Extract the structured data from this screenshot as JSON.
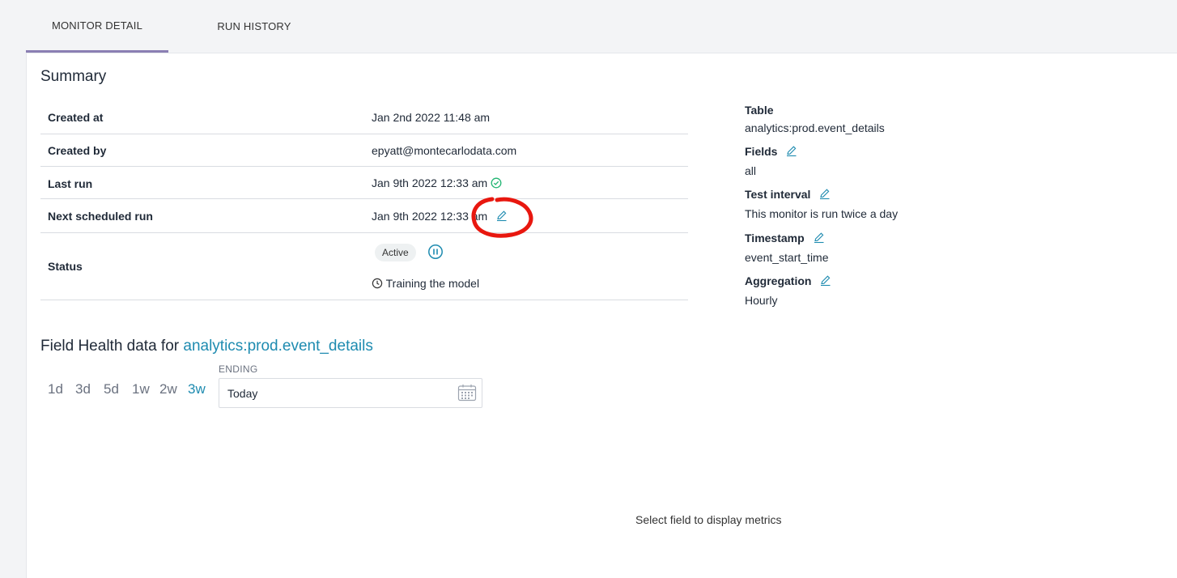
{
  "tabs": [
    {
      "label": "MONITOR DETAIL",
      "active": true
    },
    {
      "label": "RUN HISTORY",
      "active": false
    }
  ],
  "summary": {
    "title": "Summary",
    "rows": {
      "created_at": {
        "label": "Created at",
        "value": "Jan 2nd 2022 11:48 am"
      },
      "created_by": {
        "label": "Created by",
        "value": "epyatt@montecarlodata.com"
      },
      "last_run": {
        "label": "Last run",
        "value": "Jan 9th 2022 12:33 am"
      },
      "next_run": {
        "label": "Next scheduled run",
        "value": "Jan 9th 2022 12:33 am"
      },
      "status": {
        "label": "Status",
        "badge": "Active",
        "training": "Training the model"
      }
    }
  },
  "details": {
    "table": {
      "label": "Table",
      "value": "analytics:prod.event_details"
    },
    "fields": {
      "label": "Fields",
      "value": "all"
    },
    "test_interval": {
      "label": "Test interval",
      "value": "This monitor is run twice a day"
    },
    "timestamp": {
      "label": "Timestamp",
      "value": "event_start_time"
    },
    "aggregation": {
      "label": "Aggregation",
      "value": "Hourly"
    }
  },
  "field_health": {
    "title_prefix": "Field Health data for ",
    "table_link": "analytics:prod.event_details",
    "ranges": [
      "1d",
      "3d",
      "5d",
      "1w",
      "2w",
      "3w"
    ],
    "active_range": "3w",
    "ending_label": "ENDING",
    "ending_value": "Today",
    "empty_message": "Select field to display metrics"
  },
  "colors": {
    "accent": "#1e8bb0",
    "tab_underline": "#8b7fb3",
    "success": "#22b573",
    "annotation": "#e8170f"
  },
  "icons": [
    "check-circle-icon",
    "edit-icon",
    "pause-icon",
    "clock-icon",
    "calendar-icon"
  ]
}
